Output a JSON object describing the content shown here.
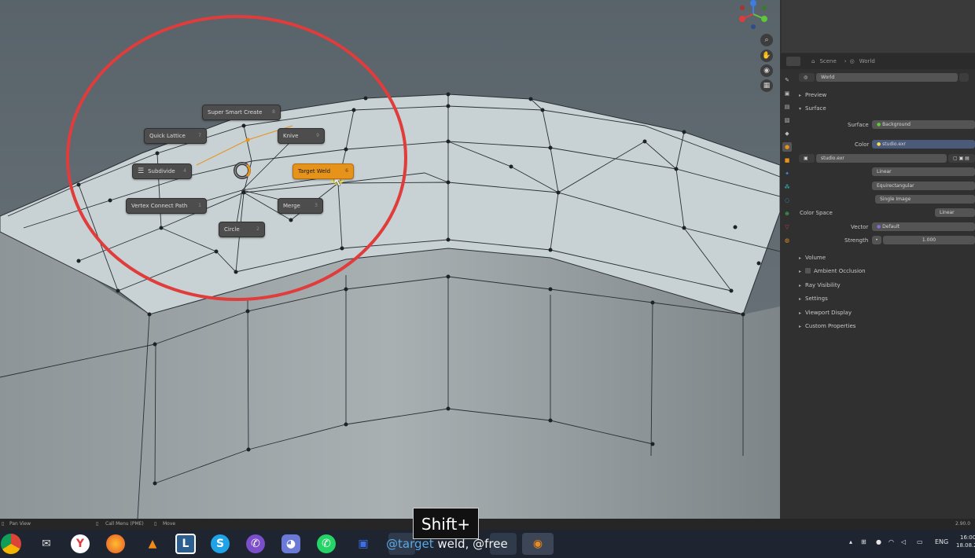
{
  "pie_menu": {
    "items": [
      {
        "label": "Super Smart Create",
        "num": "8"
      },
      {
        "label": "Quick Lattice",
        "num": "7"
      },
      {
        "label": "Knive",
        "num": "9"
      },
      {
        "label": "Subdivide",
        "num": "4"
      },
      {
        "label": "Target Weld",
        "num": "6"
      },
      {
        "label": "Vertex Connect Path",
        "num": "1"
      },
      {
        "label": "Merge",
        "num": "3"
      },
      {
        "label": "Circle",
        "num": "2"
      }
    ]
  },
  "properties": {
    "breadcrumb_scene": "Scene",
    "breadcrumb_world": "World",
    "world_name": "World",
    "sections": {
      "preview": "Preview",
      "surface": "Surface",
      "volume": "Volume",
      "ambient_occlusion": "Ambient Occlusion",
      "ray_visibility": "Ray Visibility",
      "settings": "Settings",
      "viewport_display": "Viewport Display",
      "custom_properties": "Custom Properties"
    },
    "surface_label": "Surface",
    "surface_value": "Background",
    "color_label": "Color",
    "color_value": "studio.exr",
    "image_name": "studio.exr",
    "interpolation": "Linear",
    "projection": "Equirectangular",
    "image_source": "Single Image",
    "color_space_label": "Color Space",
    "color_space_value": "Linear",
    "vector_label": "Vector",
    "vector_value": "Default",
    "strength_label": "Strength",
    "strength_value": "1.000"
  },
  "statusbar": {
    "pan": "Pan View",
    "call_menu": "Call Menu (PME)",
    "move": "Move",
    "version": "2.90.0"
  },
  "taskbar": {
    "lang": "ENG",
    "time": "16:00",
    "date": "18.08.2"
  },
  "overlay": {
    "keycast": "Shift+",
    "caption_tag": "@target",
    "caption_rest": " weld, @free"
  },
  "colors": {
    "accent": "#e6931c",
    "annotation": "#e03c3c"
  }
}
